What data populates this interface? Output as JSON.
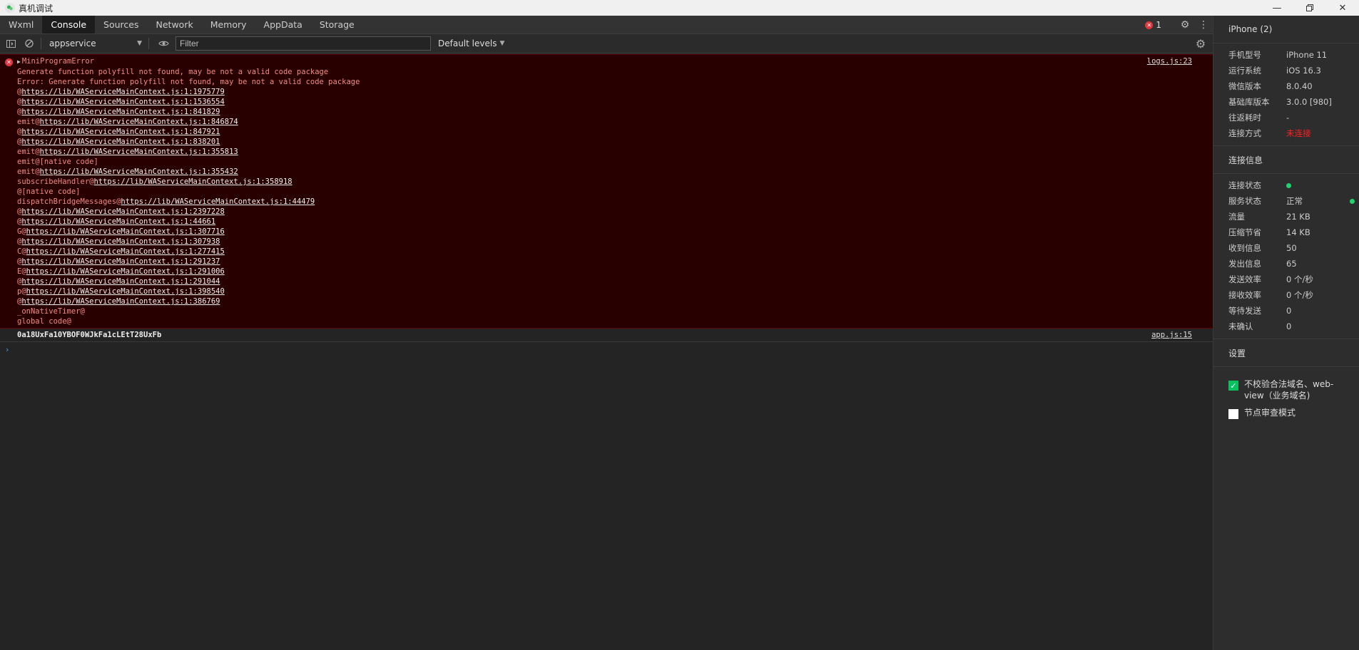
{
  "window": {
    "title": "真机调试"
  },
  "tabs": [
    "Wxml",
    "Console",
    "Sources",
    "Network",
    "Memory",
    "AppData",
    "Storage"
  ],
  "active_tab": "Console",
  "error_count": "1",
  "toolbar": {
    "context": "appservice",
    "filter_placeholder": "Filter",
    "levels": "Default levels"
  },
  "console": {
    "error": {
      "source": "logs.js:23",
      "lines": [
        {
          "prefix": "MiniProgramError",
          "url": "",
          "suffix": ""
        },
        {
          "prefix": "Generate function polyfill not found, may be not a valid code package",
          "url": "",
          "suffix": ""
        },
        {
          "prefix": "Error: Generate function polyfill not found, may be not a valid code package",
          "url": "",
          "suffix": ""
        },
        {
          "prefix": "@",
          "url": "https://lib/WAServiceMainContext.js:1:1975779",
          "suffix": ""
        },
        {
          "prefix": "@",
          "url": "https://lib/WAServiceMainContext.js:1:1536554",
          "suffix": ""
        },
        {
          "prefix": "@",
          "url": "https://lib/WAServiceMainContext.js:1:841829",
          "suffix": ""
        },
        {
          "prefix": "emit@",
          "url": "https://lib/WAServiceMainContext.js:1:846874",
          "suffix": ""
        },
        {
          "prefix": "@",
          "url": "https://lib/WAServiceMainContext.js:1:847921",
          "suffix": ""
        },
        {
          "prefix": "@",
          "url": "https://lib/WAServiceMainContext.js:1:838201",
          "suffix": ""
        },
        {
          "prefix": "emit@",
          "url": "https://lib/WAServiceMainContext.js:1:355813",
          "suffix": ""
        },
        {
          "prefix": "emit@[native code]",
          "url": "",
          "suffix": ""
        },
        {
          "prefix": "emit@",
          "url": "https://lib/WAServiceMainContext.js:1:355432",
          "suffix": ""
        },
        {
          "prefix": "subscribeHandler@",
          "url": "https://lib/WAServiceMainContext.js:1:358918",
          "suffix": ""
        },
        {
          "prefix": "@[native code]",
          "url": "",
          "suffix": ""
        },
        {
          "prefix": "dispatchBridgeMessages@",
          "url": "https://lib/WAServiceMainContext.js:1:44479",
          "suffix": ""
        },
        {
          "prefix": "@",
          "url": "https://lib/WAServiceMainContext.js:1:2397228",
          "suffix": ""
        },
        {
          "prefix": "@",
          "url": "https://lib/WAServiceMainContext.js:1:44661",
          "suffix": ""
        },
        {
          "prefix": "G@",
          "url": "https://lib/WAServiceMainContext.js:1:307716",
          "suffix": ""
        },
        {
          "prefix": "@",
          "url": "https://lib/WAServiceMainContext.js:1:307938",
          "suffix": ""
        },
        {
          "prefix": "C@",
          "url": "https://lib/WAServiceMainContext.js:1:277415",
          "suffix": ""
        },
        {
          "prefix": "@",
          "url": "https://lib/WAServiceMainContext.js:1:291237",
          "suffix": ""
        },
        {
          "prefix": "E@",
          "url": "https://lib/WAServiceMainContext.js:1:291006",
          "suffix": ""
        },
        {
          "prefix": "@",
          "url": "https://lib/WAServiceMainContext.js:1:291044",
          "suffix": ""
        },
        {
          "prefix": "p@",
          "url": "https://lib/WAServiceMainContext.js:1:398540",
          "suffix": ""
        },
        {
          "prefix": "@",
          "url": "https://lib/WAServiceMainContext.js:1:386769",
          "suffix": ""
        },
        {
          "prefix": "_onNativeTimer@",
          "url": "",
          "suffix": ""
        },
        {
          "prefix": "global code@",
          "url": "",
          "suffix": ""
        }
      ]
    },
    "log": {
      "text": "0a18UxFa10YBOF0WJkFa1cLEtT28UxFb",
      "source": "app.js:15"
    }
  },
  "device": {
    "title": "iPhone (2)",
    "info": [
      {
        "k": "手机型号",
        "v": "iPhone 11"
      },
      {
        "k": "运行系统",
        "v": "iOS 16.3"
      },
      {
        "k": "微信版本",
        "v": "8.0.40"
      },
      {
        "k": "基础库版本",
        "v": "3.0.0 [980]"
      },
      {
        "k": "往返耗时",
        "v": "-"
      },
      {
        "k": "连接方式",
        "v": "未连接"
      }
    ],
    "connection_header": "连接信息",
    "conn_status_label": "连接状态",
    "conn_stats": [
      {
        "k": "服务状态",
        "v": "正常"
      },
      {
        "k": "流量",
        "v": "21 KB"
      },
      {
        "k": "压缩节省",
        "v": "14 KB"
      },
      {
        "k": "收到信息",
        "v": "50"
      },
      {
        "k": "发出信息",
        "v": "65"
      },
      {
        "k": "发送效率",
        "v": "0 个/秒"
      },
      {
        "k": "接收效率",
        "v": "0 个/秒"
      },
      {
        "k": "等待发送",
        "v": "0"
      },
      {
        "k": "未确认",
        "v": "0"
      }
    ],
    "settings_header": "设置",
    "settings": [
      {
        "label": "不校验合法域名、web-view（业务域名)",
        "checked": true
      },
      {
        "label": "节点审查模式",
        "checked": false
      }
    ],
    "colors": {
      "accent_green": "#07c160",
      "error_red": "#e0383e",
      "disconnected_red": "#ff2020"
    }
  }
}
